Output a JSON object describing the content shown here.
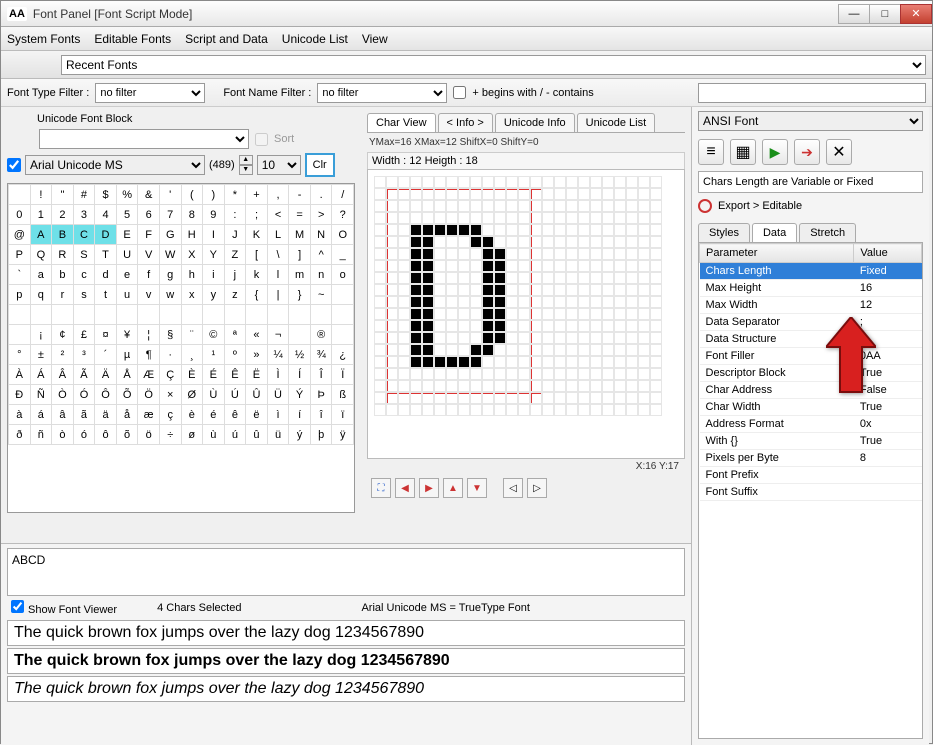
{
  "window": {
    "title": "Font Panel [Font Script Mode]"
  },
  "menu": {
    "system_fonts": "System Fonts",
    "editable_fonts": "Editable Fonts",
    "script_data": "Script and Data",
    "unicode_list": "Unicode List",
    "view": "View"
  },
  "recent": {
    "label": "Recent Fonts"
  },
  "filters": {
    "type_label": "Font Type Filter :",
    "type_value": "no filter",
    "name_label": "Font Name Filter :",
    "name_value": "no filter",
    "begins_label": "+ begins with / - contains"
  },
  "block": {
    "label": "Unicode Font Block",
    "sort": "Sort"
  },
  "font": {
    "name": "Arial Unicode MS",
    "count": "(489)",
    "size": "10",
    "clr": "Clr"
  },
  "charview": {
    "tabs": {
      "char": "Char View",
      "info": "< Info >",
      "uinfo": "Unicode Info",
      "ulist": "Unicode List"
    },
    "maxline": "YMax=16  XMax=12  ShiftX=0  ShiftY=0",
    "dimline": "Width : 12  Heigth : 18",
    "status": "X:16 Y:17"
  },
  "selection": {
    "text": "ABCD"
  },
  "status": {
    "show": "Show Font Viewer",
    "count": "4 Chars Selected",
    "tt": "Arial Unicode MS = TrueType Font"
  },
  "sample": "The quick brown fox jumps over the lazy dog 1234567890",
  "right": {
    "font": "ANSI Font",
    "note": "Chars Length are Variable or Fixed",
    "export": "Export > Editable",
    "tabs": {
      "styles": "Styles",
      "data": "Data",
      "stretch": "Stretch"
    },
    "headers": {
      "param": "Parameter",
      "value": "Value"
    },
    "rows": [
      {
        "p": "Chars Length",
        "v": "Fixed",
        "sel": true
      },
      {
        "p": "Max Height",
        "v": "16"
      },
      {
        "p": "Max Width",
        "v": "12"
      },
      {
        "p": "Data Separator",
        "v": ";"
      },
      {
        "p": "Data Structure",
        "v": ""
      },
      {
        "p": "Font Filler",
        "v": "0AA"
      },
      {
        "p": "Descriptor Block",
        "v": "True"
      },
      {
        "p": "Char Address",
        "v": "False"
      },
      {
        "p": "Char Width",
        "v": "True"
      },
      {
        "p": "Address Format",
        "v": "0x"
      },
      {
        "p": "With {}",
        "v": "True"
      },
      {
        "p": "Pixels per Byte",
        "v": "8"
      },
      {
        "p": "Font Prefix",
        "v": ""
      },
      {
        "p": "Font Suffix",
        "v": ""
      }
    ]
  },
  "chars": [
    [
      " ",
      "!",
      "\"",
      "#",
      "$",
      "%",
      "&",
      "'",
      "(",
      ")",
      "*",
      "+",
      ",",
      "-",
      ".",
      "/"
    ],
    [
      "0",
      "1",
      "2",
      "3",
      "4",
      "5",
      "6",
      "7",
      "8",
      "9",
      ":",
      ";",
      "<",
      "=",
      ">",
      "?"
    ],
    [
      "@",
      "A",
      "B",
      "C",
      "D",
      "E",
      "F",
      "G",
      "H",
      "I",
      "J",
      "K",
      "L",
      "M",
      "N",
      "O"
    ],
    [
      "P",
      "Q",
      "R",
      "S",
      "T",
      "U",
      "V",
      "W",
      "X",
      "Y",
      "Z",
      "[",
      "\\",
      "]",
      "^",
      "_"
    ],
    [
      "`",
      "a",
      "b",
      "c",
      "d",
      "e",
      "f",
      "g",
      "h",
      "i",
      "j",
      "k",
      "l",
      "m",
      "n",
      "o"
    ],
    [
      "p",
      "q",
      "r",
      "s",
      "t",
      "u",
      "v",
      "w",
      "x",
      "y",
      "z",
      "{",
      "|",
      "}",
      "~",
      " "
    ],
    [
      " ",
      " ",
      " ",
      " ",
      " ",
      " ",
      " ",
      " ",
      " ",
      " ",
      " ",
      " ",
      " ",
      " ",
      " ",
      " "
    ],
    [
      " ",
      "¡",
      "¢",
      "£",
      "¤",
      "¥",
      "¦",
      "§",
      "¨",
      "©",
      "ª",
      "«",
      "¬",
      " ",
      "®",
      " "
    ],
    [
      "°",
      "±",
      "²",
      "³",
      "´",
      "µ",
      "¶",
      "·",
      "¸",
      "¹",
      "º",
      "»",
      "¼",
      "½",
      "¾",
      "¿"
    ],
    [
      "À",
      "Á",
      "Â",
      "Ã",
      "Ä",
      "Å",
      "Æ",
      "Ç",
      "È",
      "É",
      "Ê",
      "Ë",
      "Ì",
      "Í",
      "Î",
      "Ï"
    ],
    [
      "Ð",
      "Ñ",
      "Ò",
      "Ó",
      "Ô",
      "Õ",
      "Ö",
      "×",
      "Ø",
      "Ù",
      "Ú",
      "Û",
      "Ü",
      "Ý",
      "Þ",
      "ß"
    ],
    [
      "à",
      "á",
      "â",
      "ã",
      "ä",
      "å",
      "æ",
      "ç",
      "è",
      "é",
      "ê",
      "ë",
      "ì",
      "í",
      "î",
      "ï"
    ],
    [
      "ð",
      "ñ",
      "ò",
      "ó",
      "ô",
      "õ",
      "ö",
      "÷",
      "ø",
      "ù",
      "ú",
      "û",
      "ü",
      "ý",
      "þ",
      "ÿ"
    ]
  ],
  "selected_cells": [
    [
      2,
      1
    ],
    [
      2,
      2
    ],
    [
      2,
      3
    ],
    [
      2,
      4
    ]
  ],
  "glyph_D": [
    [
      1,
      0
    ],
    [
      2,
      0
    ],
    [
      3,
      0
    ],
    [
      4,
      0
    ],
    [
      5,
      0
    ],
    [
      6,
      0
    ],
    [
      1,
      1
    ],
    [
      2,
      1
    ],
    [
      6,
      1
    ],
    [
      7,
      1
    ],
    [
      1,
      2
    ],
    [
      2,
      2
    ],
    [
      7,
      2
    ],
    [
      8,
      2
    ],
    [
      1,
      3
    ],
    [
      2,
      3
    ],
    [
      7,
      3
    ],
    [
      8,
      3
    ],
    [
      1,
      4
    ],
    [
      2,
      4
    ],
    [
      7,
      4
    ],
    [
      8,
      4
    ],
    [
      1,
      5
    ],
    [
      2,
      5
    ],
    [
      7,
      5
    ],
    [
      8,
      5
    ],
    [
      1,
      6
    ],
    [
      2,
      6
    ],
    [
      7,
      6
    ],
    [
      8,
      6
    ],
    [
      1,
      7
    ],
    [
      2,
      7
    ],
    [
      7,
      7
    ],
    [
      8,
      7
    ],
    [
      1,
      8
    ],
    [
      2,
      8
    ],
    [
      7,
      8
    ],
    [
      8,
      8
    ],
    [
      1,
      9
    ],
    [
      2,
      9
    ],
    [
      7,
      9
    ],
    [
      8,
      9
    ],
    [
      1,
      10
    ],
    [
      2,
      10
    ],
    [
      6,
      10
    ],
    [
      7,
      10
    ],
    [
      1,
      11
    ],
    [
      2,
      11
    ],
    [
      3,
      11
    ],
    [
      4,
      11
    ],
    [
      5,
      11
    ],
    [
      6,
      11
    ]
  ]
}
